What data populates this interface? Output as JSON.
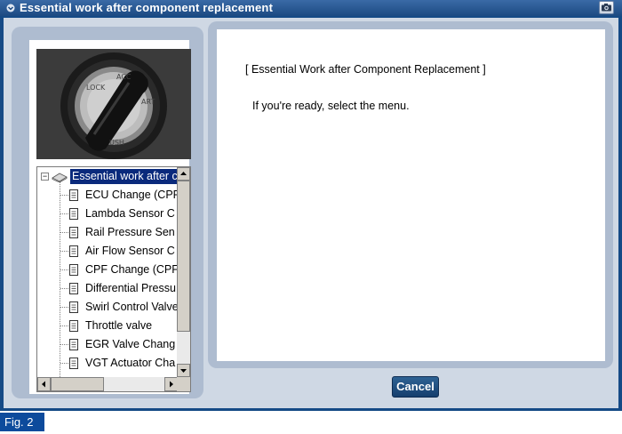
{
  "window": {
    "title": "Essential work after component replacement",
    "camera_icon": "camera-icon"
  },
  "tree": {
    "root_label": "Essential work after c",
    "items": [
      "ECU Change (CPF",
      "Lambda Sensor C",
      "Rail Pressure Sen",
      "Air Flow Sensor C",
      "CPF Change (CPF",
      "Differential Pressu",
      "Swirl Control Valve",
      "Throttle valve",
      "EGR Valve Chang",
      "VGT Actuator Cha"
    ]
  },
  "content": {
    "heading": "[ Essential Work after Component Replacement ]",
    "message": "If you're ready, select the menu."
  },
  "buttons": {
    "cancel_label": "Cancel"
  },
  "figure_label": "Fig. 2",
  "colors": {
    "title_bar": "#1c4a82",
    "selection": "#0a2a7c",
    "panel": "#aebcd0",
    "button": "#1f4f80"
  }
}
